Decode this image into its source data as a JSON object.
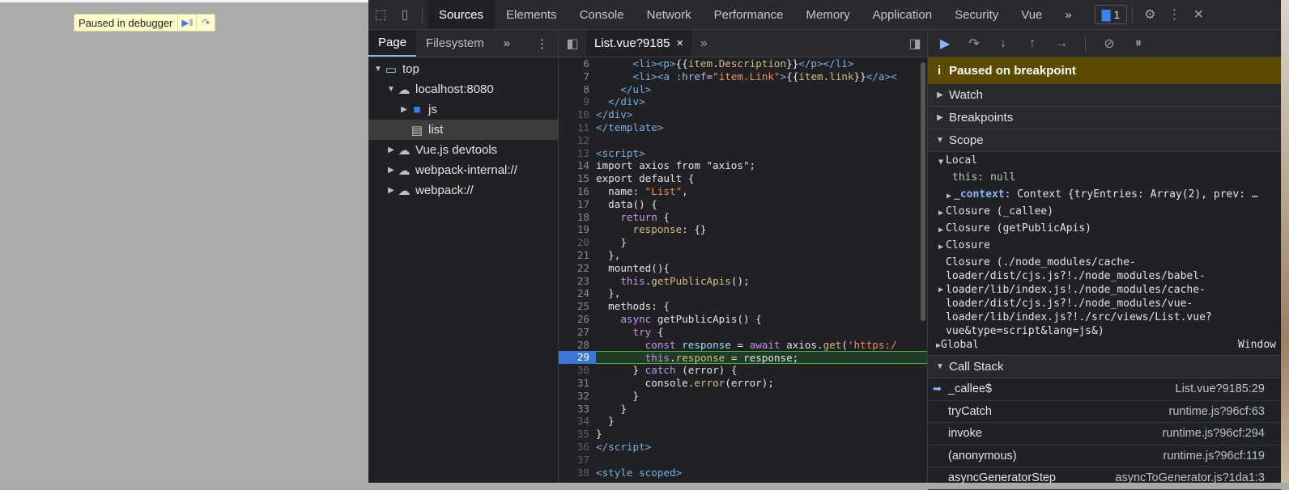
{
  "page": {
    "paused_text": "Paused in debugger",
    "resume_icon": "resume-icon",
    "stepover_icon": "step-over-icon"
  },
  "topbar": {
    "tabs": [
      "Sources",
      "Elements",
      "Console",
      "Network",
      "Performance",
      "Memory",
      "Application",
      "Security",
      "Vue"
    ],
    "active_tab": "Sources",
    "more": "»",
    "issues_count": "1"
  },
  "navigator": {
    "tabs": [
      "Page",
      "Filesystem"
    ],
    "more": "»",
    "tree": [
      {
        "label": "top",
        "depth": 0,
        "icon": "frame-icon",
        "expanded": true
      },
      {
        "label": "localhost:8080",
        "depth": 1,
        "icon": "cloud-icon",
        "expanded": true
      },
      {
        "label": "js",
        "depth": 2,
        "icon": "folder-icon",
        "expanded": false
      },
      {
        "label": "list",
        "depth": 2,
        "icon": "file-icon",
        "selected": true
      },
      {
        "label": "Vue.js devtools",
        "depth": 1,
        "icon": "cloud-icon",
        "expanded": false
      },
      {
        "label": "webpack-internal://",
        "depth": 1,
        "icon": "cloud-icon",
        "expanded": false
      },
      {
        "label": "webpack://",
        "depth": 1,
        "icon": "cloud-icon",
        "expanded": false
      }
    ]
  },
  "editor": {
    "file_tab": "List.vue?9185",
    "close": "×",
    "more": "»",
    "breakpoint_line": 29,
    "lines": [
      {
        "n": "6",
        "html": "      <span class=\"tag\">&lt;li&gt;&lt;p&gt;</span>{{<span class=\"fn\">item</span>.<span class=\"fn\">Description</span>}}<span class=\"tag\">&lt;/p&gt;&lt;/li&gt;</span>"
      },
      {
        "n": "7",
        "html": "      <span class=\"tag\">&lt;li&gt;&lt;a</span> <span class=\"attr\">:href</span>=<span class=\"str\">\"item.Link\"</span><span class=\"tag\">&gt;</span>{{<span class=\"fn\">item</span>.<span class=\"fn\">link</span>}}<span class=\"tag\">&lt;/a&gt;&lt;</span>"
      },
      {
        "n": "8",
        "html": "    <span class=\"tag\">&lt;/ul&gt;</span>"
      },
      {
        "n": "9",
        "html": "  <span class=\"tag\">&lt;/div&gt;</span>",
        "dim": true
      },
      {
        "n": "10",
        "html": "<span class=\"tag\">&lt;/div&gt;</span>",
        "dim": true
      },
      {
        "n": "11",
        "html": "<span class=\"tag\">&lt;/template&gt;</span>",
        "dim": true
      },
      {
        "n": "12",
        "html": "",
        "dim": true
      },
      {
        "n": "13",
        "html": "<span class=\"tag\">&lt;script&gt;</span>",
        "dim": true
      },
      {
        "n": "14",
        "html": "import axios from \"axios\";"
      },
      {
        "n": "15",
        "html": "export default {"
      },
      {
        "n": "16",
        "html": "  name: <span class=\"str\">\"List\"</span>,"
      },
      {
        "n": "17",
        "html": "  data() {"
      },
      {
        "n": "18",
        "html": "    <span class=\"kw\">return</span> {"
      },
      {
        "n": "19",
        "html": "      <span class=\"fn\">response</span>: {}"
      },
      {
        "n": "20",
        "html": "    }",
        "dim": true
      },
      {
        "n": "21",
        "html": "  },"
      },
      {
        "n": "22",
        "html": "  mounted(){"
      },
      {
        "n": "23",
        "html": "    <span class=\"kw\">this</span>.<span class=\"fn\">getPublicApis</span>();"
      },
      {
        "n": "24",
        "html": "  },"
      },
      {
        "n": "25",
        "html": "  methods: {"
      },
      {
        "n": "26",
        "html": "    <span class=\"kw\">async</span> getPublicApis() {"
      },
      {
        "n": "27",
        "html": "      <span class=\"kw\">try</span> {"
      },
      {
        "n": "28",
        "html": "        <span class=\"kw\">const</span> <span class=\"prop\">response</span> = <span class=\"kw\">await</span> axios.<span class=\"fn\">get</span>(<span class=\"str\">'https:/</span>"
      },
      {
        "n": "29",
        "html": "        <span class=\"kw\">this</span>.<span class=\"fn\">response</span> = response;",
        "bp": true
      },
      {
        "n": "30",
        "html": "      } <span class=\"kw\">catch</span> (error) {",
        "dim": true
      },
      {
        "n": "31",
        "html": "        console.<span class=\"fn\">error</span>(error);"
      },
      {
        "n": "32",
        "html": "      }"
      },
      {
        "n": "33",
        "html": "    }"
      },
      {
        "n": "34",
        "html": "  }",
        "dim": true
      },
      {
        "n": "35",
        "html": "}",
        "dim": true
      },
      {
        "n": "36",
        "html": "<span class=\"tag\">&lt;/script&gt;</span>",
        "dim": true
      },
      {
        "n": "37",
        "html": "",
        "dim": true
      },
      {
        "n": "38",
        "html": "<span class=\"tag\">&lt;style scoped&gt;</span>",
        "dim": true
      }
    ]
  },
  "debugger": {
    "banner": "Paused on breakpoint",
    "info_icon": "i",
    "watch": "Watch",
    "breakpoints": "Breakpoints",
    "scope": "Scope",
    "local": "Local",
    "this_null": "this: null",
    "context_key": "_context",
    "context_val": ": Context {tryEntries: Array(2), prev: …",
    "closure_callee": "Closure (_callee)",
    "closure_getpublicapis": "Closure (getPublicApis)",
    "closure": "Closure",
    "closure_long": "Closure (./node_modules/cache-loader/dist/cjs.js?!./node_modules/babel-loader/lib/index.js!./node_modules/cache-loader/dist/cjs.js?!./node_modules/vue-loader/lib/index.js?!./src/views/List.vue?vue&type=script&lang=js&)",
    "closure_long_lines": [
      "Closure (./node_modules/cache-",
      "loader/dist/cjs.js?!./node_modules/babel-",
      "loader/lib/index.js!./node_modules/cache-",
      "loader/dist/cjs.js?!./node_modules/vue-",
      "loader/lib/index.js?!./src/views/List.vue?",
      "vue&type=script&lang=js&)"
    ],
    "global": "Global",
    "global_val": "Window",
    "call_stack": "Call Stack",
    "frames": [
      {
        "fn": "_callee$",
        "loc": "List.vue?9185:29",
        "current": true
      },
      {
        "fn": "tryCatch",
        "loc": "runtime.js?96cf:63"
      },
      {
        "fn": "invoke",
        "loc": "runtime.js?96cf:294"
      },
      {
        "fn": "(anonymous)",
        "loc": "runtime.js?96cf:119"
      },
      {
        "fn": "asyncGeneratorStep",
        "loc": "asyncToGenerator.js?1da1:3"
      }
    ]
  }
}
